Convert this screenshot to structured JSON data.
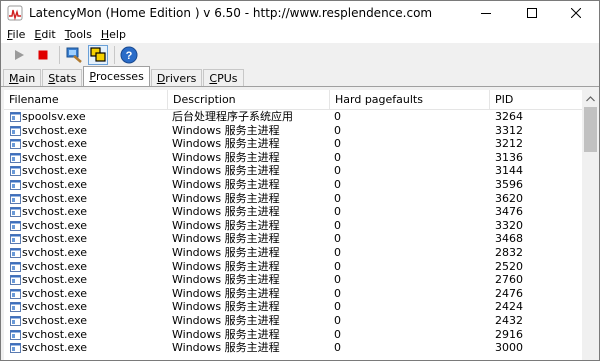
{
  "window": {
    "title": "LatencyMon  (Home Edition )  v 6.50 - http://www.resplendence.com"
  },
  "menu": [
    {
      "key": "F",
      "rest": "ile"
    },
    {
      "key": "E",
      "rest": "dit"
    },
    {
      "key": "T",
      "rest": "ools"
    },
    {
      "key": "H",
      "rest": "elp"
    }
  ],
  "toolbar": {
    "icons": [
      "play-icon",
      "stop-icon",
      "analyze-icon",
      "windows-icon",
      "help-icon"
    ]
  },
  "tabs": [
    {
      "key": "M",
      "rest": "ain",
      "active": false
    },
    {
      "key": "S",
      "rest": "tats",
      "active": false
    },
    {
      "key": "P",
      "rest": "rocesses",
      "active": true
    },
    {
      "key": "D",
      "rest": "rivers",
      "active": false
    },
    {
      "key": "C",
      "rest": "PUs",
      "active": false
    }
  ],
  "table": {
    "columns": [
      "Filename",
      "Description",
      "Hard pagefaults",
      "PID"
    ],
    "rows": [
      [
        "spoolsv.exe",
        "后台处理程序子系统应用",
        "0",
        "3264"
      ],
      [
        "svchost.exe",
        "Windows 服务主进程",
        "0",
        "3312"
      ],
      [
        "svchost.exe",
        "Windows 服务主进程",
        "0",
        "3212"
      ],
      [
        "svchost.exe",
        "Windows 服务主进程",
        "0",
        "3136"
      ],
      [
        "svchost.exe",
        "Windows 服务主进程",
        "0",
        "3144"
      ],
      [
        "svchost.exe",
        "Windows 服务主进程",
        "0",
        "3596"
      ],
      [
        "svchost.exe",
        "Windows 服务主进程",
        "0",
        "3620"
      ],
      [
        "svchost.exe",
        "Windows 服务主进程",
        "0",
        "3476"
      ],
      [
        "svchost.exe",
        "Windows 服务主进程",
        "0",
        "3320"
      ],
      [
        "svchost.exe",
        "Windows 服务主进程",
        "0",
        "3468"
      ],
      [
        "svchost.exe",
        "Windows 服务主进程",
        "0",
        "2832"
      ],
      [
        "svchost.exe",
        "Windows 服务主进程",
        "0",
        "2520"
      ],
      [
        "svchost.exe",
        "Windows 服务主进程",
        "0",
        "2760"
      ],
      [
        "svchost.exe",
        "Windows 服务主进程",
        "0",
        "2476"
      ],
      [
        "svchost.exe",
        "Windows 服务主进程",
        "0",
        "2424"
      ],
      [
        "svchost.exe",
        "Windows 服务主进程",
        "0",
        "2432"
      ],
      [
        "svchost.exe",
        "Windows 服务主进程",
        "0",
        "2916"
      ],
      [
        "svchost.exe",
        "Windows 服务主进程",
        "0",
        "3000"
      ]
    ]
  }
}
